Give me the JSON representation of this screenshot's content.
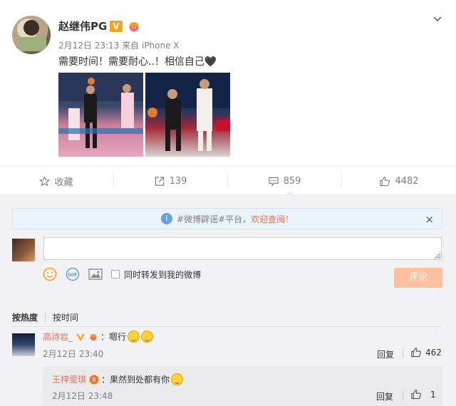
{
  "post": {
    "username": "赵继伟PG",
    "v_badge": "V",
    "time": "2月12日 23:13",
    "source_prefix": "来自",
    "source": "iPhone X",
    "text": "需要时间！需要耐心..！相信自己🖤"
  },
  "actions": {
    "favorite": "收藏",
    "repost_count": "139",
    "comment_count": "859",
    "like_count": "4482"
  },
  "notice": {
    "part1": "#微博辟谣#平台，",
    "highlight": "欢迎查阅！",
    "close": "×"
  },
  "composer": {
    "placeholder": "",
    "repost_label": "同时转发到我的微博",
    "submit_label": "评论"
  },
  "sort": {
    "active": "按热度",
    "other": "按时间"
  },
  "comment": {
    "user": "高诗岩_",
    "text": "：嗯行",
    "time": "2月12日 23:40",
    "reply_label": "回复",
    "likes": "462"
  },
  "subreply": {
    "user": "王梓雯琪",
    "text": "：果然到处都有你",
    "time": "2月12日 23:48",
    "reply_label": "回复",
    "likes": "1"
  },
  "colors": {
    "accent": "#eb7350",
    "submit_disabled": "#ffc09f",
    "vip_gold": "#f9a21a"
  }
}
